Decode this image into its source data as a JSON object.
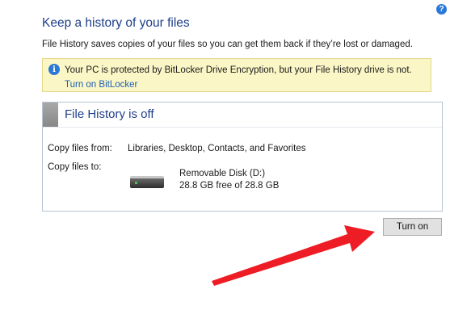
{
  "help": {
    "icon": "question-help-icon",
    "glyph": "?"
  },
  "page": {
    "title": "Keep a history of your files",
    "description": "File History saves copies of your files so you can get them back if they’re lost or damaged."
  },
  "warning": {
    "icon": "info-icon",
    "glyph": "i",
    "text": "Your PC is protected by BitLocker Drive Encryption, but your File History drive is not.",
    "link": "Turn on BitLocker"
  },
  "status": {
    "title": "File History is off",
    "copy_from_label": "Copy files from:",
    "copy_from_value": "Libraries, Desktop, Contacts, and Favorites",
    "copy_to_label": "Copy files to:",
    "drive": {
      "icon": "hard-drive-icon",
      "name": "Removable Disk (D:)",
      "space": "28.8 GB free of 28.8 GB"
    }
  },
  "actions": {
    "turn_on": "Turn on"
  },
  "annotation": {
    "arrow_color": "#ee1c24"
  },
  "colors": {
    "accent": "#1e3f8a",
    "link": "#1a5fb4",
    "warning_bg": "#fbf6c6"
  }
}
